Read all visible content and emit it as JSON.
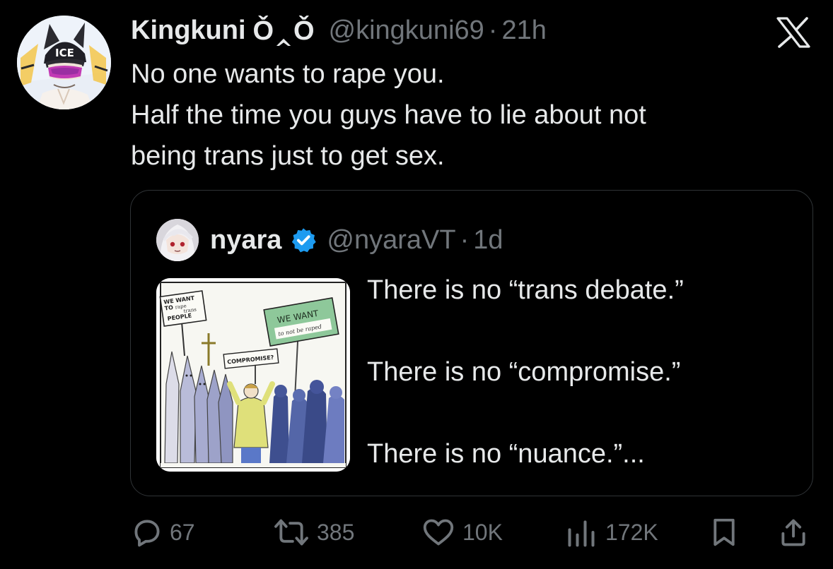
{
  "tweet": {
    "display_name": "Kingkuni",
    "name_emoji": "Ǒ‸Ǒ",
    "handle": "@kingkuni69",
    "separator": "·",
    "time": "21h",
    "avatar_cap_text": "ICE",
    "text_lines": [
      "No one wants to rape you.",
      "Half the time you guys have to lie about not",
      "being trans just to get sex."
    ]
  },
  "quote": {
    "display_name": "nyara",
    "verified": true,
    "handle": "@nyaraVT",
    "separator": "·",
    "time": "1d",
    "image_signs": {
      "left_sign_line1": "WE WANT",
      "left_sign_line2": "TO",
      "left_sign_word1": "rape",
      "left_sign_word2": "trans",
      "left_sign_line3": "PEOPLE",
      "right_sign_line1": "WE WANT",
      "right_sign_line2": "to not be raped",
      "center_sign": "COMPROMISE?"
    },
    "text_lines": [
      "There is no “trans debate.”",
      "There is no “compromise.”",
      "There is no “nuance.”..."
    ]
  },
  "actions": {
    "replies": "67",
    "reposts": "385",
    "likes": "10K",
    "views": "172K"
  },
  "icons": {
    "platform": "x-logo-icon",
    "reply": "reply-icon",
    "repost": "repost-icon",
    "like": "like-icon",
    "views": "views-icon",
    "bookmark": "bookmark-icon",
    "share": "share-icon",
    "verified": "verified-badge-icon"
  },
  "colors": {
    "background": "#000000",
    "text_primary": "#e7e9ea",
    "text_secondary": "#71767b",
    "border": "#2f3336",
    "verified": "#1d9bf0"
  }
}
